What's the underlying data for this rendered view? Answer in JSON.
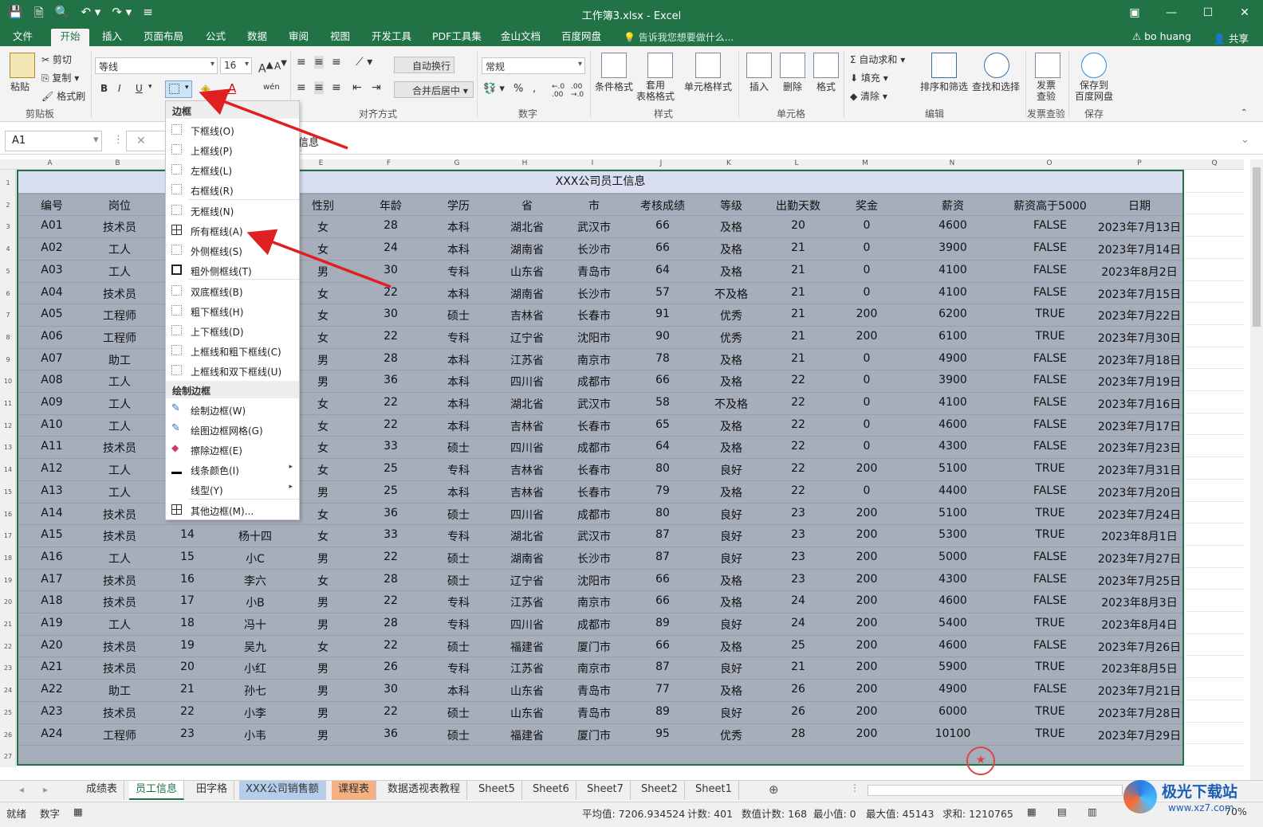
{
  "window": {
    "title": "工作簿3.xlsx - Excel"
  },
  "ribbon_tabs": [
    "文件",
    "开始",
    "插入",
    "页面布局",
    "公式",
    "数据",
    "审阅",
    "视图",
    "开发工具",
    "PDF工具集",
    "金山文档",
    "百度网盘"
  ],
  "tell_me": "告诉我您想要做什么...",
  "user": "bo huang",
  "share": "共享",
  "clipboard": {
    "paste": "粘贴",
    "cut": "剪切",
    "copy": "复制",
    "format_painter": "格式刷",
    "group": "剪贴板"
  },
  "font": {
    "name": "等线",
    "size": "16",
    "bold": "B",
    "italic": "I",
    "underline": "U",
    "group": "字体"
  },
  "alignment": {
    "wrap": "自动换行",
    "merge": "合并后居中",
    "group": "对齐方式"
  },
  "number": {
    "format": "常规",
    "percent": "%",
    "comma": ",",
    "group": "数字"
  },
  "styles": {
    "conditional": "条件格式",
    "table": "套用\n表格格式",
    "cell_style": "单元格样式",
    "group": "样式"
  },
  "cells": {
    "insert": "插入",
    "delete": "删除",
    "format": "格式",
    "group": "单元格"
  },
  "editing": {
    "autosum": "自动求和",
    "fill": "填充",
    "clear": "清除",
    "sort": "排序和筛选",
    "find": "查找和选择",
    "group": "编辑"
  },
  "invoice": {
    "label": "发票\n查验",
    "group": "发票查验"
  },
  "save": {
    "label": "保存到\n百度网盘",
    "group": "保存"
  },
  "formula_bar": {
    "cell_ref": "A1",
    "cancel": "✕",
    "value": "信息"
  },
  "columns": [
    "A",
    "B",
    "C",
    "D",
    "E",
    "F",
    "G",
    "H",
    "I",
    "J",
    "K",
    "L",
    "M",
    "N",
    "O",
    "P",
    "Q"
  ],
  "sheet_title": "XXX公司员工信息",
  "headers": [
    "编号",
    "岗位",
    "",
    "",
    "性别",
    "年龄",
    "学历",
    "省",
    "市",
    "考核成绩",
    "等级",
    "出勤天数",
    "奖金",
    "薪资",
    "薪资高于5000",
    "日期"
  ],
  "rows": [
    [
      "A01",
      "技术员",
      "",
      "",
      "女",
      "28",
      "本科",
      "湖北省",
      "武汉市",
      "66",
      "及格",
      "20",
      "0",
      "4600",
      "FALSE",
      "2023年7月13日"
    ],
    [
      "A02",
      "工人",
      "",
      "",
      "女",
      "24",
      "本科",
      "湖南省",
      "长沙市",
      "66",
      "及格",
      "21",
      "0",
      "3900",
      "FALSE",
      "2023年7月14日"
    ],
    [
      "A03",
      "工人",
      "",
      "",
      "男",
      "30",
      "专科",
      "山东省",
      "青岛市",
      "64",
      "及格",
      "21",
      "0",
      "4100",
      "FALSE",
      "2023年8月2日"
    ],
    [
      "A04",
      "技术员",
      "",
      "",
      "女",
      "22",
      "本科",
      "湖南省",
      "长沙市",
      "57",
      "不及格",
      "21",
      "0",
      "4100",
      "FALSE",
      "2023年7月15日"
    ],
    [
      "A05",
      "工程师",
      "",
      "",
      "女",
      "30",
      "硕士",
      "吉林省",
      "长春市",
      "91",
      "优秀",
      "21",
      "200",
      "6200",
      "TRUE",
      "2023年7月22日"
    ],
    [
      "A06",
      "工程师",
      "",
      "",
      "女",
      "22",
      "专科",
      "辽宁省",
      "沈阳市",
      "90",
      "优秀",
      "21",
      "200",
      "6100",
      "TRUE",
      "2023年7月30日"
    ],
    [
      "A07",
      "助工",
      "",
      "",
      "男",
      "28",
      "本科",
      "江苏省",
      "南京市",
      "78",
      "及格",
      "21",
      "0",
      "4900",
      "FALSE",
      "2023年7月18日"
    ],
    [
      "A08",
      "工人",
      "",
      "",
      "男",
      "36",
      "本科",
      "四川省",
      "成都市",
      "66",
      "及格",
      "22",
      "0",
      "3900",
      "FALSE",
      "2023年7月19日"
    ],
    [
      "A09",
      "工人",
      "",
      "",
      "女",
      "22",
      "本科",
      "湖北省",
      "武汉市",
      "58",
      "不及格",
      "22",
      "0",
      "4100",
      "FALSE",
      "2023年7月16日"
    ],
    [
      "A10",
      "工人",
      "",
      "",
      "女",
      "22",
      "本科",
      "吉林省",
      "长春市",
      "65",
      "及格",
      "22",
      "0",
      "4600",
      "FALSE",
      "2023年7月17日"
    ],
    [
      "A11",
      "技术员",
      "",
      "",
      "女",
      "33",
      "硕士",
      "四川省",
      "成都市",
      "64",
      "及格",
      "22",
      "0",
      "4300",
      "FALSE",
      "2023年7月23日"
    ],
    [
      "A12",
      "工人",
      "",
      "",
      "女",
      "25",
      "专科",
      "吉林省",
      "长春市",
      "80",
      "良好",
      "22",
      "200",
      "5100",
      "TRUE",
      "2023年7月31日"
    ],
    [
      "A13",
      "工人",
      "",
      "",
      "男",
      "25",
      "本科",
      "吉林省",
      "长春市",
      "79",
      "及格",
      "22",
      "0",
      "4400",
      "FALSE",
      "2023年7月20日"
    ],
    [
      "A14",
      "技术员",
      "",
      "",
      "女",
      "36",
      "硕士",
      "四川省",
      "成都市",
      "80",
      "良好",
      "23",
      "200",
      "5100",
      "TRUE",
      "2023年7月24日"
    ],
    [
      "A15",
      "技术员",
      "14",
      "杨十四",
      "女",
      "33",
      "专科",
      "湖北省",
      "武汉市",
      "87",
      "良好",
      "23",
      "200",
      "5300",
      "TRUE",
      "2023年8月1日"
    ],
    [
      "A16",
      "工人",
      "15",
      "小C",
      "男",
      "22",
      "硕士",
      "湖南省",
      "长沙市",
      "87",
      "良好",
      "23",
      "200",
      "5000",
      "FALSE",
      "2023年7月27日"
    ],
    [
      "A17",
      "技术员",
      "16",
      "李六",
      "女",
      "28",
      "硕士",
      "辽宁省",
      "沈阳市",
      "66",
      "及格",
      "23",
      "200",
      "4300",
      "FALSE",
      "2023年7月25日"
    ],
    [
      "A18",
      "技术员",
      "17",
      "小B",
      "男",
      "22",
      "专科",
      "江苏省",
      "南京市",
      "66",
      "及格",
      "24",
      "200",
      "4600",
      "FALSE",
      "2023年8月3日"
    ],
    [
      "A19",
      "工人",
      "18",
      "冯十",
      "男",
      "28",
      "专科",
      "四川省",
      "成都市",
      "89",
      "良好",
      "24",
      "200",
      "5400",
      "TRUE",
      "2023年8月4日"
    ],
    [
      "A20",
      "技术员",
      "19",
      "吴九",
      "女",
      "22",
      "硕士",
      "福建省",
      "厦门市",
      "66",
      "及格",
      "25",
      "200",
      "4600",
      "FALSE",
      "2023年7月26日"
    ],
    [
      "A21",
      "技术员",
      "20",
      "小红",
      "男",
      "26",
      "专科",
      "江苏省",
      "南京市",
      "87",
      "良好",
      "21",
      "200",
      "5900",
      "TRUE",
      "2023年8月5日"
    ],
    [
      "A22",
      "助工",
      "21",
      "孙七",
      "男",
      "30",
      "本科",
      "山东省",
      "青岛市",
      "77",
      "及格",
      "26",
      "200",
      "4900",
      "FALSE",
      "2023年7月21日"
    ],
    [
      "A23",
      "技术员",
      "22",
      "小李",
      "男",
      "22",
      "硕士",
      "山东省",
      "青岛市",
      "89",
      "良好",
      "26",
      "200",
      "6000",
      "TRUE",
      "2023年7月28日"
    ],
    [
      "A24",
      "工程师",
      "23",
      "小韦",
      "男",
      "36",
      "硕士",
      "福建省",
      "厦门市",
      "95",
      "优秀",
      "28",
      "200",
      "10100",
      "TRUE",
      "2023年7月29日"
    ]
  ],
  "border_menu": {
    "section1": "边框",
    "items1": [
      "下框线(O)",
      "上框线(P)",
      "左框线(L)",
      "右框线(R)",
      "无框线(N)",
      "所有框线(A)",
      "外侧框线(S)",
      "粗外侧框线(T)",
      "双底框线(B)",
      "粗下框线(H)",
      "上下框线(D)",
      "上框线和粗下框线(C)",
      "上框线和双下框线(U)"
    ],
    "section2": "绘制边框",
    "items2": [
      "绘制边框(W)",
      "绘图边框网格(G)",
      "擦除边框(E)",
      "线条颜色(I)",
      "线型(Y)",
      "其他边框(M)..."
    ]
  },
  "sheet_tabs": [
    "成绩表",
    "员工信息",
    "田字格",
    "XXX公司销售额",
    "课程表",
    "数据透视表教程",
    "Sheet5",
    "Sheet6",
    "Sheet7",
    "Sheet2",
    "Sheet1"
  ],
  "status": {
    "ready": "就绪",
    "mode": "数字",
    "average": "平均值: 7206.934524",
    "count": "计数: 401",
    "numcount": "数值计数: 168",
    "min": "最小值: 0",
    "max": "最大值: 45143",
    "sum": "求和: 1210765",
    "zoom": "70%"
  },
  "watermark": "极光下载站",
  "watermark_url": "www.xz7.com",
  "accent": "#217346",
  "arrow_color": "#e02020"
}
